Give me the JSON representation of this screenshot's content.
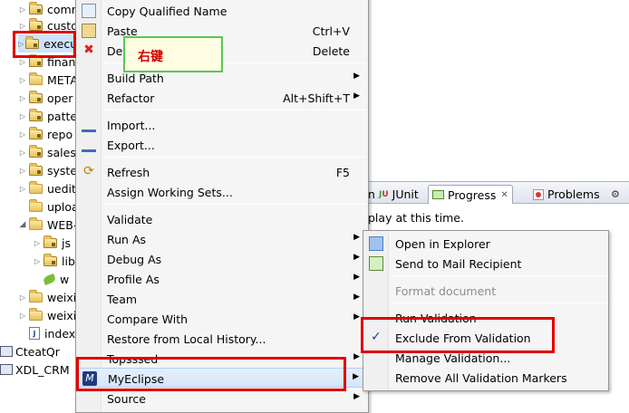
{
  "tree": {
    "items": [
      {
        "label": "comr",
        "kind": "pkg"
      },
      {
        "label": "custo",
        "kind": "pkg"
      },
      {
        "label": "execu",
        "kind": "pkg"
      },
      {
        "label": "finan",
        "kind": "pkg"
      },
      {
        "label": "META",
        "kind": "folder"
      },
      {
        "label": "oper",
        "kind": "pkg"
      },
      {
        "label": "patte",
        "kind": "pkg"
      },
      {
        "label": "repo",
        "kind": "pkg"
      },
      {
        "label": "sales",
        "kind": "pkg"
      },
      {
        "label": "syste",
        "kind": "pkg"
      },
      {
        "label": "uedit",
        "kind": "folder"
      },
      {
        "label": "uploa",
        "kind": "folder"
      },
      {
        "label": "WEB-",
        "kind": "folder"
      },
      {
        "label": "js",
        "kind": "folder"
      },
      {
        "label": "lib",
        "kind": "folder"
      },
      {
        "label": "w",
        "kind": "leaf"
      },
      {
        "label": "weixi",
        "kind": "folder"
      },
      {
        "label": "weixi",
        "kind": "folder"
      },
      {
        "label": "index",
        "kind": "jfile"
      },
      {
        "label": "CteatQr",
        "kind": "project"
      },
      {
        "label": "XDL_CRM",
        "kind": "project"
      }
    ]
  },
  "annotation": {
    "label": "右键"
  },
  "context_menu": {
    "items": [
      {
        "label": "Copy Qualified Name",
        "shortcut": "",
        "submenu": false
      },
      {
        "label": "Paste",
        "shortcut": "Ctrl+V",
        "submenu": false
      },
      {
        "label": "Dele",
        "shortcut": "Delete",
        "submenu": false
      },
      {
        "label": "Build Path",
        "shortcut": "",
        "submenu": true
      },
      {
        "label": "Refactor",
        "shortcut": "Alt+Shift+T",
        "submenu": true
      },
      {
        "label": "Import...",
        "shortcut": "",
        "submenu": false
      },
      {
        "label": "Export...",
        "shortcut": "",
        "submenu": false
      },
      {
        "label": "Refresh",
        "shortcut": "F5",
        "submenu": false
      },
      {
        "label": "Assign Working Sets...",
        "shortcut": "",
        "submenu": false
      },
      {
        "label": "Validate",
        "shortcut": "",
        "submenu": false
      },
      {
        "label": "Run As",
        "shortcut": "",
        "submenu": true
      },
      {
        "label": "Debug As",
        "shortcut": "",
        "submenu": true
      },
      {
        "label": "Profile As",
        "shortcut": "",
        "submenu": true
      },
      {
        "label": "Team",
        "shortcut": "",
        "submenu": true
      },
      {
        "label": "Compare With",
        "shortcut": "",
        "submenu": true
      },
      {
        "label": "Restore from Local History...",
        "shortcut": "",
        "submenu": false
      },
      {
        "label": "Topsssed",
        "shortcut": "",
        "submenu": true
      },
      {
        "label": "MyEclipse",
        "shortcut": "",
        "submenu": true
      },
      {
        "label": "Source",
        "shortcut": "",
        "submenu": true
      }
    ]
  },
  "sub_menu": {
    "items": [
      {
        "label": "Open in Explorer",
        "enabled": true,
        "checked": false
      },
      {
        "label": "Send to Mail Recipient",
        "enabled": true,
        "checked": false
      },
      {
        "label": "Format document",
        "enabled": false,
        "checked": false
      },
      {
        "label": "Run Validation",
        "enabled": true,
        "checked": false
      },
      {
        "label": "Exclude From Validation",
        "enabled": true,
        "checked": true
      },
      {
        "label": "Manage Validation...",
        "enabled": true,
        "checked": false
      },
      {
        "label": "Remove All Validation Markers",
        "enabled": true,
        "checked": false
      }
    ]
  },
  "views": {
    "tabs": [
      {
        "label": "n"
      },
      {
        "label": "JUnit"
      },
      {
        "label": "Progress"
      },
      {
        "label": "Problems"
      }
    ],
    "status": "play at this time."
  },
  "colors": {
    "highlight_box": "#e00000",
    "note_border": "#58c758",
    "note_text": "#d40000"
  }
}
